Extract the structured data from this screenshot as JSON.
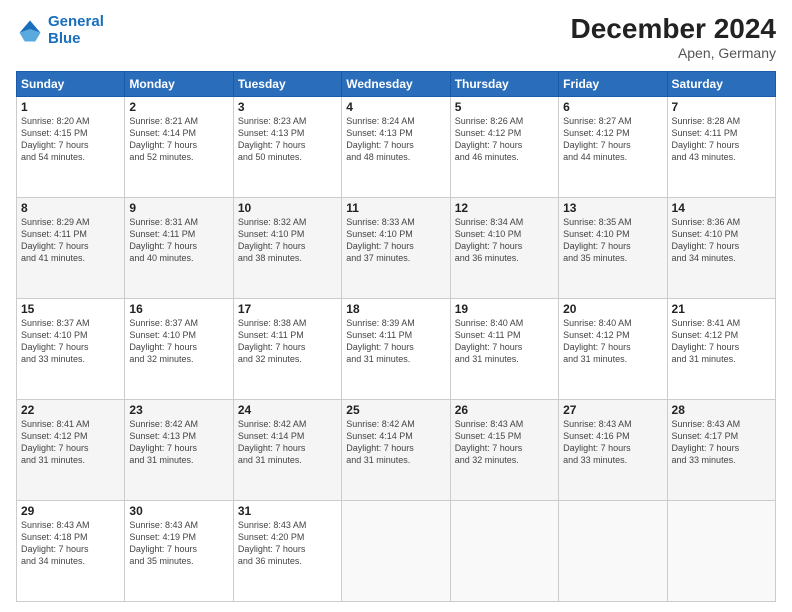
{
  "logo": {
    "line1": "General",
    "line2": "Blue"
  },
  "title": "December 2024",
  "subtitle": "Apen, Germany",
  "days_of_week": [
    "Sunday",
    "Monday",
    "Tuesday",
    "Wednesday",
    "Thursday",
    "Friday",
    "Saturday"
  ],
  "weeks": [
    [
      {
        "day": "1",
        "sunrise": "8:20 AM",
        "sunset": "4:15 PM",
        "daylight": "7 hours and 54 minutes."
      },
      {
        "day": "2",
        "sunrise": "8:21 AM",
        "sunset": "4:14 PM",
        "daylight": "7 hours and 52 minutes."
      },
      {
        "day": "3",
        "sunrise": "8:23 AM",
        "sunset": "4:13 PM",
        "daylight": "7 hours and 50 minutes."
      },
      {
        "day": "4",
        "sunrise": "8:24 AM",
        "sunset": "4:13 PM",
        "daylight": "7 hours and 48 minutes."
      },
      {
        "day": "5",
        "sunrise": "8:26 AM",
        "sunset": "4:12 PM",
        "daylight": "7 hours and 46 minutes."
      },
      {
        "day": "6",
        "sunrise": "8:27 AM",
        "sunset": "4:12 PM",
        "daylight": "7 hours and 44 minutes."
      },
      {
        "day": "7",
        "sunrise": "8:28 AM",
        "sunset": "4:11 PM",
        "daylight": "7 hours and 43 minutes."
      }
    ],
    [
      {
        "day": "8",
        "sunrise": "8:29 AM",
        "sunset": "4:11 PM",
        "daylight": "7 hours and 41 minutes."
      },
      {
        "day": "9",
        "sunrise": "8:31 AM",
        "sunset": "4:11 PM",
        "daylight": "7 hours and 40 minutes."
      },
      {
        "day": "10",
        "sunrise": "8:32 AM",
        "sunset": "4:10 PM",
        "daylight": "7 hours and 38 minutes."
      },
      {
        "day": "11",
        "sunrise": "8:33 AM",
        "sunset": "4:10 PM",
        "daylight": "7 hours and 37 minutes."
      },
      {
        "day": "12",
        "sunrise": "8:34 AM",
        "sunset": "4:10 PM",
        "daylight": "7 hours and 36 minutes."
      },
      {
        "day": "13",
        "sunrise": "8:35 AM",
        "sunset": "4:10 PM",
        "daylight": "7 hours and 35 minutes."
      },
      {
        "day": "14",
        "sunrise": "8:36 AM",
        "sunset": "4:10 PM",
        "daylight": "7 hours and 34 minutes."
      }
    ],
    [
      {
        "day": "15",
        "sunrise": "8:37 AM",
        "sunset": "4:10 PM",
        "daylight": "7 hours and 33 minutes."
      },
      {
        "day": "16",
        "sunrise": "8:37 AM",
        "sunset": "4:10 PM",
        "daylight": "7 hours and 32 minutes."
      },
      {
        "day": "17",
        "sunrise": "8:38 AM",
        "sunset": "4:11 PM",
        "daylight": "7 hours and 32 minutes."
      },
      {
        "day": "18",
        "sunrise": "8:39 AM",
        "sunset": "4:11 PM",
        "daylight": "7 hours and 31 minutes."
      },
      {
        "day": "19",
        "sunrise": "8:40 AM",
        "sunset": "4:11 PM",
        "daylight": "7 hours and 31 minutes."
      },
      {
        "day": "20",
        "sunrise": "8:40 AM",
        "sunset": "4:12 PM",
        "daylight": "7 hours and 31 minutes."
      },
      {
        "day": "21",
        "sunrise": "8:41 AM",
        "sunset": "4:12 PM",
        "daylight": "7 hours and 31 minutes."
      }
    ],
    [
      {
        "day": "22",
        "sunrise": "8:41 AM",
        "sunset": "4:12 PM",
        "daylight": "7 hours and 31 minutes."
      },
      {
        "day": "23",
        "sunrise": "8:42 AM",
        "sunset": "4:13 PM",
        "daylight": "7 hours and 31 minutes."
      },
      {
        "day": "24",
        "sunrise": "8:42 AM",
        "sunset": "4:14 PM",
        "daylight": "7 hours and 31 minutes."
      },
      {
        "day": "25",
        "sunrise": "8:42 AM",
        "sunset": "4:14 PM",
        "daylight": "7 hours and 31 minutes."
      },
      {
        "day": "26",
        "sunrise": "8:43 AM",
        "sunset": "4:15 PM",
        "daylight": "7 hours and 32 minutes."
      },
      {
        "day": "27",
        "sunrise": "8:43 AM",
        "sunset": "4:16 PM",
        "daylight": "7 hours and 33 minutes."
      },
      {
        "day": "28",
        "sunrise": "8:43 AM",
        "sunset": "4:17 PM",
        "daylight": "7 hours and 33 minutes."
      }
    ],
    [
      {
        "day": "29",
        "sunrise": "8:43 AM",
        "sunset": "4:18 PM",
        "daylight": "7 hours and 34 minutes."
      },
      {
        "day": "30",
        "sunrise": "8:43 AM",
        "sunset": "4:19 PM",
        "daylight": "7 hours and 35 minutes."
      },
      {
        "day": "31",
        "sunrise": "8:43 AM",
        "sunset": "4:20 PM",
        "daylight": "7 hours and 36 minutes."
      },
      null,
      null,
      null,
      null
    ]
  ]
}
